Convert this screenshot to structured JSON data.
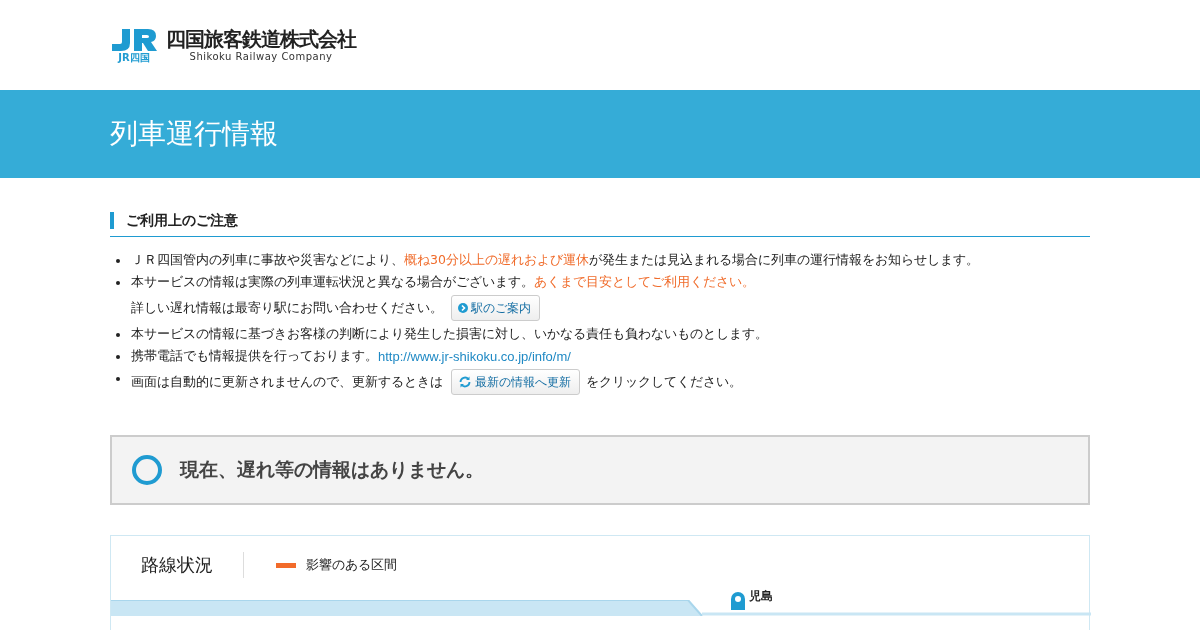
{
  "header": {
    "company_name": "四国旅客鉄道株式会社",
    "company_name_en": "Shikoku Railway Company",
    "logo_caption": "JR四国"
  },
  "page_title": "列車運行情報",
  "notice": {
    "heading": "ご利用上のご注意",
    "items": [
      {
        "lines": [
          [
            {
              "kind": "text",
              "text": "ＪＲ四国管内の列車に事故や災害などにより、"
            },
            {
              "kind": "emphasis",
              "text": "概ね30分以上の遅れおよび運休"
            },
            {
              "kind": "text",
              "text": "が発生または見込まれる場合に列車の運行情報をお知らせします。"
            }
          ]
        ]
      },
      {
        "lines": [
          [
            {
              "kind": "text",
              "text": "本サービスの情報は実際の列車運転状況と異なる場合がございます。"
            },
            {
              "kind": "emphasis",
              "text": "あくまで目安としてご利用ください。"
            }
          ],
          [
            {
              "kind": "text",
              "text": "詳しい遅れ情報は最寄り駅にお問い合わせください。"
            },
            {
              "kind": "guide_button",
              "text": "駅のご案内"
            }
          ]
        ]
      },
      {
        "lines": [
          [
            {
              "kind": "text",
              "text": "本サービスの情報に基づきお客様の判断により発生した損害に対し、いかなる責任も負わないものとします。"
            }
          ]
        ]
      },
      {
        "lines": [
          [
            {
              "kind": "text",
              "text": "携帯電話でも情報提供を行っております。"
            },
            {
              "kind": "link",
              "text": "http://www.jr-shikoku.co.jp/info/m/"
            }
          ]
        ]
      },
      {
        "lines": [
          [
            {
              "kind": "text",
              "text": "画面は自動的に更新されませんので、更新するときは"
            },
            {
              "kind": "refresh_button",
              "text": "最新の情報へ更新"
            },
            {
              "kind": "text",
              "text": "をクリックしてください。"
            }
          ]
        ]
      }
    ]
  },
  "status": {
    "message": "現在、遅れ等の情報はありません。"
  },
  "route": {
    "title": "路線状況",
    "legend": {
      "label": "影響のある区間",
      "color": "#f26b2a"
    },
    "station": "児島"
  }
}
